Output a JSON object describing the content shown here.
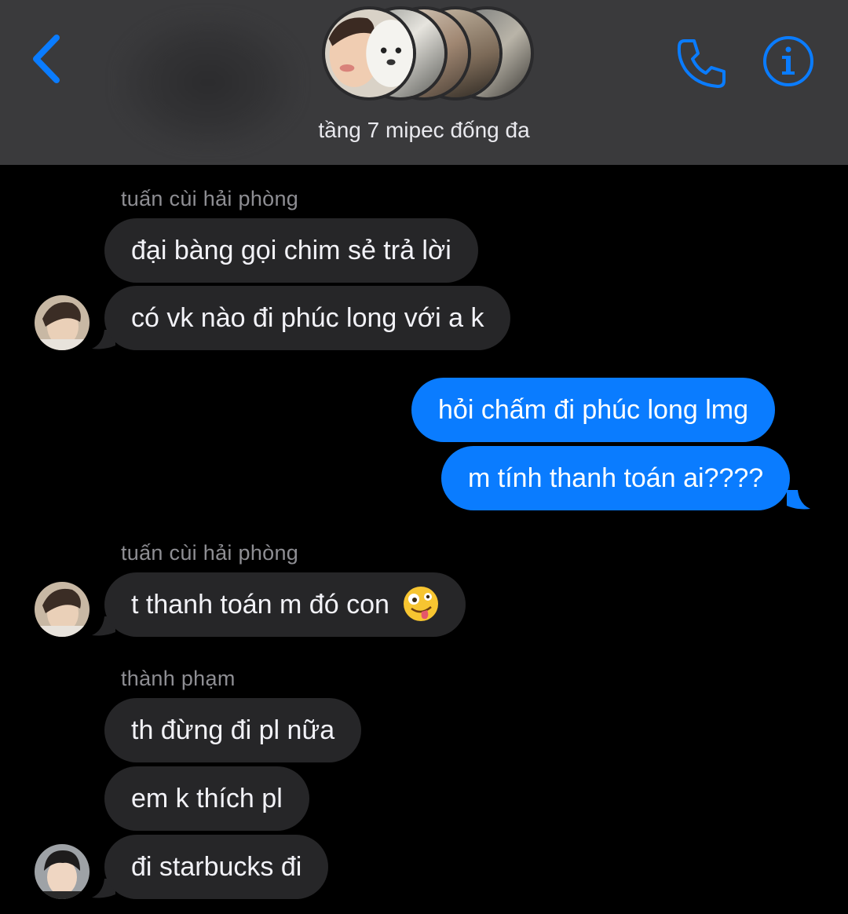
{
  "header": {
    "group_name": "tầng 7 mipec đống đa",
    "back_icon": "chevron-left-icon",
    "call_icon": "phone-icon",
    "info_icon": "info-icon",
    "accent_color": "#0a7cff",
    "header_bg": "#3a3a3c"
  },
  "messages": [
    {
      "sender": "tuấn cùi hải phòng"
    },
    {
      "text": "đại bàng gọi chim sẻ trả lời",
      "direction": "incoming"
    },
    {
      "text": "có vk nào đi phúc long với a k",
      "direction": "incoming"
    },
    {
      "text": "hỏi chấm đi phúc long lmg",
      "direction": "outgoing"
    },
    {
      "text": "m tính thanh toán ai????",
      "direction": "outgoing"
    },
    {
      "sender": "tuấn cùi hải phòng"
    },
    {
      "text": "t thanh toán m đó con",
      "direction": "incoming",
      "emoji": "zany-face-emoji"
    },
    {
      "sender": "thành phạm"
    },
    {
      "text": "th đừng đi pl nữa",
      "direction": "incoming"
    },
    {
      "text": "em k thích pl",
      "direction": "incoming"
    },
    {
      "text": "đi starbucks đi",
      "direction": "incoming"
    }
  ],
  "colors": {
    "incoming_bubble": "#262628",
    "outgoing_bubble": "#0a7cff",
    "sender_label": "#8e8e93"
  }
}
